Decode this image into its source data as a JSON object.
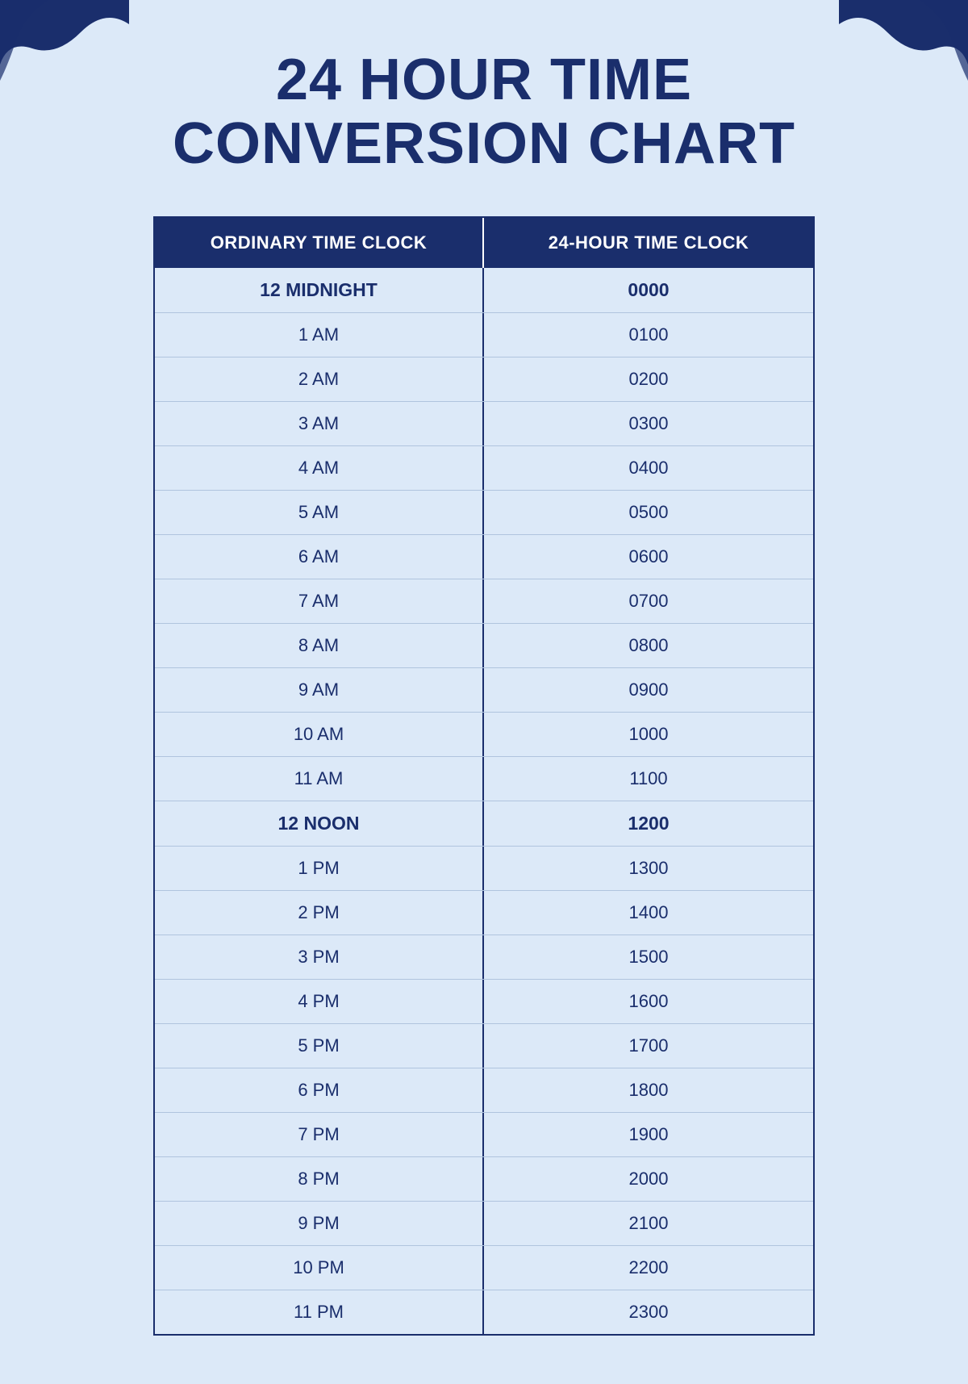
{
  "page": {
    "background_color": "#dce9f8",
    "title_line1": "24 HOUR TIME",
    "title_line2": "CONVERSION CHART"
  },
  "table": {
    "header": {
      "col1": "ORDINARY TIME CLOCK",
      "col2": "24-HOUR TIME CLOCK"
    },
    "rows": [
      {
        "ordinary": "12 MIDNIGHT",
        "military": "0000",
        "bold": true
      },
      {
        "ordinary": "1 AM",
        "military": "0100",
        "bold": false
      },
      {
        "ordinary": "2 AM",
        "military": "0200",
        "bold": false
      },
      {
        "ordinary": "3 AM",
        "military": "0300",
        "bold": false
      },
      {
        "ordinary": "4 AM",
        "military": "0400",
        "bold": false
      },
      {
        "ordinary": "5 AM",
        "military": "0500",
        "bold": false
      },
      {
        "ordinary": "6 AM",
        "military": "0600",
        "bold": false
      },
      {
        "ordinary": "7 AM",
        "military": "0700",
        "bold": false
      },
      {
        "ordinary": "8 AM",
        "military": "0800",
        "bold": false
      },
      {
        "ordinary": "9 AM",
        "military": "0900",
        "bold": false
      },
      {
        "ordinary": "10 AM",
        "military": "1000",
        "bold": false
      },
      {
        "ordinary": "11 AM",
        "military": "1100",
        "bold": false
      },
      {
        "ordinary": "12 NOON",
        "military": "1200",
        "bold": true
      },
      {
        "ordinary": "1 PM",
        "military": "1300",
        "bold": false
      },
      {
        "ordinary": "2 PM",
        "military": "1400",
        "bold": false
      },
      {
        "ordinary": "3 PM",
        "military": "1500",
        "bold": false
      },
      {
        "ordinary": "4 PM",
        "military": "1600",
        "bold": false
      },
      {
        "ordinary": "5 PM",
        "military": "1700",
        "bold": false
      },
      {
        "ordinary": "6 PM",
        "military": "1800",
        "bold": false
      },
      {
        "ordinary": "7 PM",
        "military": "1900",
        "bold": false
      },
      {
        "ordinary": "8 PM",
        "military": "2000",
        "bold": false
      },
      {
        "ordinary": "9 PM",
        "military": "2100",
        "bold": false
      },
      {
        "ordinary": "10 PM",
        "military": "2200",
        "bold": false
      },
      {
        "ordinary": "11 PM",
        "military": "2300",
        "bold": false
      }
    ]
  }
}
